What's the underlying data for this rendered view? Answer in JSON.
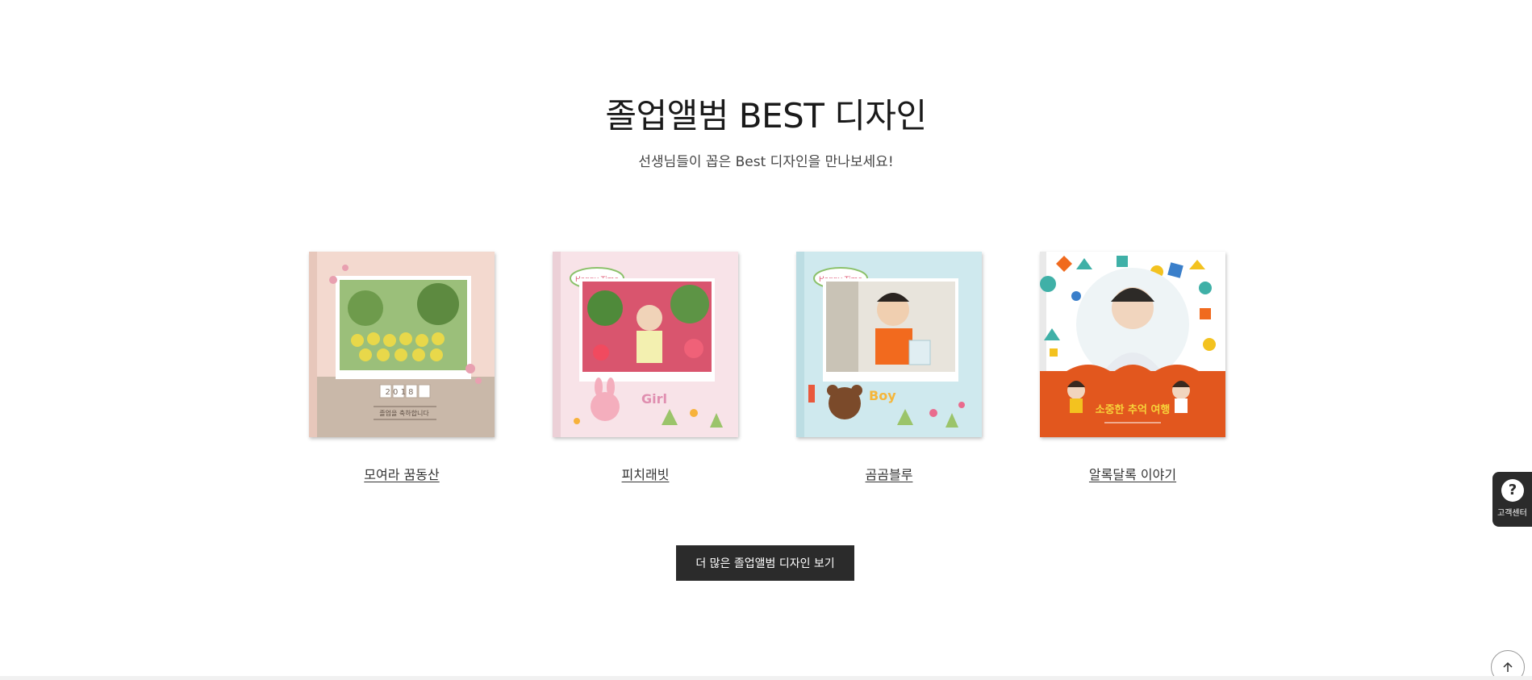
{
  "section": {
    "title": "졸업앨범 BEST 디자인",
    "subtitle": "선생님들이 꼽은 Best 디자인을 만나보세요!"
  },
  "designs": [
    {
      "name": "모여라 꿈동산",
      "cover_year": "2 0 1 8",
      "cover_caption": "졸업을 축하합니다",
      "bg": "#f3d9cf",
      "bottom": "#c9b8a9"
    },
    {
      "name": "피치래빗",
      "badge": "Happy Time",
      "bg": "#f8e3e8",
      "deco_text": "Girl"
    },
    {
      "name": "곰곰블루",
      "badge": "Happy Time",
      "bg": "#cfe9ee",
      "deco_text": "Boy"
    },
    {
      "name": "알록달록 이야기",
      "cover_caption": "소중한 추억 여행",
      "bg": "#ffffff",
      "bottom": "#e2571e"
    }
  ],
  "more_button": "더 많은 졸업앨범 디자인 보기",
  "help": {
    "label": "고객센터",
    "icon": "question-icon"
  },
  "scroll_top": {
    "icon": "arrow-up-icon"
  }
}
